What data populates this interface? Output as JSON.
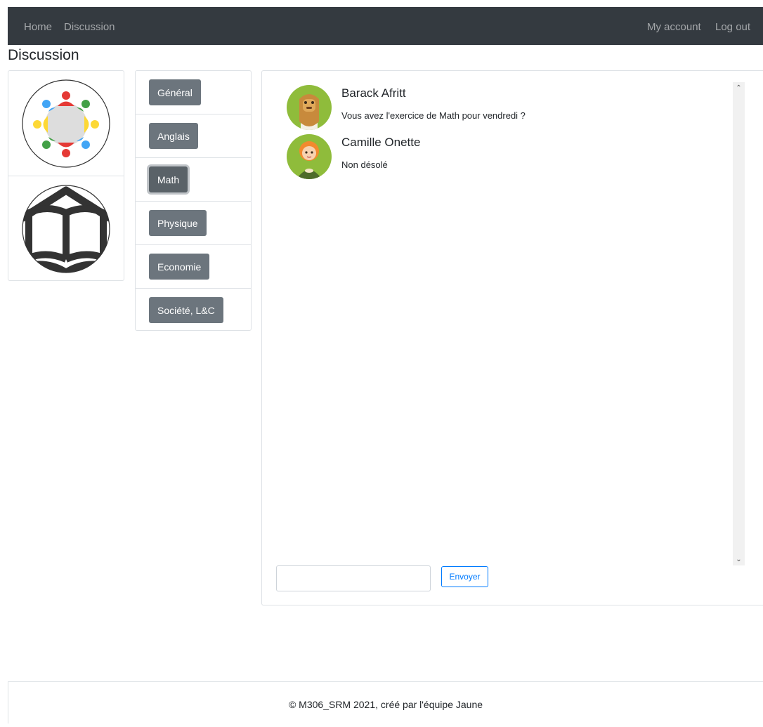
{
  "nav": {
    "home": "Home",
    "discussion": "Discussion",
    "account": "My account",
    "logout": "Log out"
  },
  "page": {
    "title": "Discussion"
  },
  "groups": [
    {
      "icon": "round-table-people-icon"
    },
    {
      "icon": "open-book-icon"
    }
  ],
  "channels": [
    {
      "label": "Général",
      "active": false
    },
    {
      "label": "Anglais",
      "active": false
    },
    {
      "label": "Math",
      "active": true
    },
    {
      "label": "Physique",
      "active": false
    },
    {
      "label": "Economie",
      "active": false
    },
    {
      "label": "Société, L&C",
      "active": false
    }
  ],
  "chat": {
    "messages": [
      {
        "author": "Barack Afritt",
        "text": "Vous avez l'exercice de Math pour vendredi ?",
        "avatar": "bearded-man-avatar-icon"
      },
      {
        "author": "Camille Onette",
        "text": "Non désolé",
        "avatar": "redhead-woman-avatar-icon"
      }
    ],
    "input_value": "",
    "send_label": "Envoyer",
    "scroll_up": "⌃",
    "scroll_down": "⌄"
  },
  "footer": {
    "text": "© M306_SRM 2021, créé par l'équipe Jaune"
  },
  "colors": {
    "navbar": "#343a40",
    "channel_button": "#6c757d",
    "active_channel_button": "#5a6268",
    "send_accent": "#007bff",
    "avatar_background": "#8fbc3b"
  }
}
